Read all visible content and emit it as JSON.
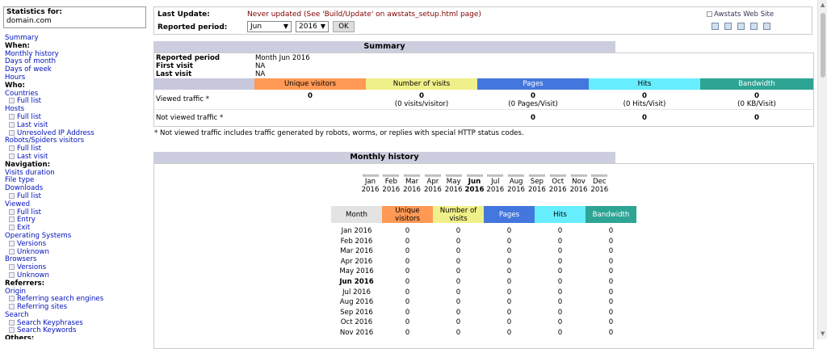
{
  "menu": {
    "stats_label": "Statistics for:",
    "domain": "domain.com",
    "items": [
      {
        "kind": "top",
        "label": "Summary"
      },
      {
        "kind": "hdr",
        "label": "When:"
      },
      {
        "kind": "top",
        "label": "Monthly history"
      },
      {
        "kind": "top",
        "label": "Days of month"
      },
      {
        "kind": "top",
        "label": "Days of week"
      },
      {
        "kind": "top",
        "label": "Hours"
      },
      {
        "kind": "hdr",
        "label": "Who:"
      },
      {
        "kind": "top",
        "label": "Countries"
      },
      {
        "kind": "sub",
        "label": "Full list"
      },
      {
        "kind": "top",
        "label": "Hosts"
      },
      {
        "kind": "sub",
        "label": "Full list"
      },
      {
        "kind": "sub",
        "label": "Last visit"
      },
      {
        "kind": "sub",
        "label": "Unresolved IP Address"
      },
      {
        "kind": "top",
        "label": "Robots/Spiders visitors"
      },
      {
        "kind": "sub",
        "label": "Full list"
      },
      {
        "kind": "sub",
        "label": "Last visit"
      },
      {
        "kind": "hdr",
        "label": "Navigation:"
      },
      {
        "kind": "top",
        "label": "Visits duration"
      },
      {
        "kind": "top",
        "label": "File type"
      },
      {
        "kind": "top",
        "label": "Downloads"
      },
      {
        "kind": "sub",
        "label": "Full list"
      },
      {
        "kind": "top",
        "label": "Viewed"
      },
      {
        "kind": "sub",
        "label": "Full list"
      },
      {
        "kind": "sub",
        "label": "Entry"
      },
      {
        "kind": "sub",
        "label": "Exit"
      },
      {
        "kind": "top",
        "label": "Operating Systems"
      },
      {
        "kind": "sub",
        "label": "Versions"
      },
      {
        "kind": "sub",
        "label": "Unknown"
      },
      {
        "kind": "top",
        "label": "Browsers"
      },
      {
        "kind": "sub",
        "label": "Versions"
      },
      {
        "kind": "sub",
        "label": "Unknown"
      },
      {
        "kind": "hdr",
        "label": "Referrers:"
      },
      {
        "kind": "top",
        "label": "Origin"
      },
      {
        "kind": "sub",
        "label": "Referring search engines"
      },
      {
        "kind": "sub",
        "label": "Referring sites"
      },
      {
        "kind": "top",
        "label": "Search"
      },
      {
        "kind": "sub",
        "label": "Search Keyphrases"
      },
      {
        "kind": "sub",
        "label": "Search Keywords"
      },
      {
        "kind": "hdr",
        "label": "Others:"
      }
    ]
  },
  "header": {
    "last_update_label": "Last Update:",
    "last_update_value": "Never updated (See 'Build/Update' on awstats_setup.html page)",
    "reported_period_label": "Reported period:",
    "month_select": "Jun",
    "year_select": "2016",
    "ok_button": "OK",
    "logo_alt": "Awstats Web Site",
    "tool_icons": [
      "tool-icon-1",
      "tool-icon-2",
      "tool-icon-3",
      "tool-icon-4",
      "tool-icon-5"
    ]
  },
  "summary": {
    "title": "Summary",
    "reported_period_label": "Reported period",
    "reported_period_value": "Month Jun 2016",
    "first_visit_label": "First visit",
    "first_visit_value": "NA",
    "last_visit_label": "Last visit",
    "last_visit_value": "NA",
    "columns": [
      "Unique visitors",
      "Number of visits",
      "Pages",
      "Hits",
      "Bandwidth"
    ],
    "viewed_label": "Viewed traffic *",
    "viewed": {
      "unique_visitors": "0",
      "visits": "0",
      "visits_sub": "(0 visits/visitor)",
      "pages": "0",
      "pages_sub": "(0 Pages/Visit)",
      "hits": "0",
      "hits_sub": "(0 Hits/Visit)",
      "bandwidth": "0",
      "bandwidth_sub": "(0 KB/Visit)"
    },
    "not_viewed_label": "Not viewed traffic *",
    "not_viewed": {
      "pages": "0",
      "hits": "0",
      "bandwidth": "0"
    },
    "note": "* Not viewed traffic includes traffic generated by robots, worms, or replies with special HTTP status codes."
  },
  "monthly": {
    "title": "Monthly history",
    "chart_months": [
      {
        "m": "Jan",
        "y": "2016"
      },
      {
        "m": "Feb",
        "y": "2016"
      },
      {
        "m": "Mar",
        "y": "2016"
      },
      {
        "m": "Apr",
        "y": "2016"
      },
      {
        "m": "May",
        "y": "2016"
      },
      {
        "m": "Jun",
        "y": "2016",
        "current": true
      },
      {
        "m": "Jul",
        "y": "2016"
      },
      {
        "m": "Aug",
        "y": "2016"
      },
      {
        "m": "Sep",
        "y": "2016"
      },
      {
        "m": "Oct",
        "y": "2016"
      },
      {
        "m": "Nov",
        "y": "2016"
      },
      {
        "m": "Dec",
        "y": "2016"
      }
    ],
    "table_headers": [
      "Month",
      "Unique visitors",
      "Number of visits",
      "Pages",
      "Hits",
      "Bandwidth"
    ],
    "rows": [
      {
        "month": "Jan 2016",
        "uv": "0",
        "nv": "0",
        "pg": "0",
        "ht": "0",
        "bw": "0"
      },
      {
        "month": "Feb 2016",
        "uv": "0",
        "nv": "0",
        "pg": "0",
        "ht": "0",
        "bw": "0"
      },
      {
        "month": "Mar 2016",
        "uv": "0",
        "nv": "0",
        "pg": "0",
        "ht": "0",
        "bw": "0"
      },
      {
        "month": "Apr 2016",
        "uv": "0",
        "nv": "0",
        "pg": "0",
        "ht": "0",
        "bw": "0"
      },
      {
        "month": "May 2016",
        "uv": "0",
        "nv": "0",
        "pg": "0",
        "ht": "0",
        "bw": "0"
      },
      {
        "month": "Jun 2016",
        "uv": "0",
        "nv": "0",
        "pg": "0",
        "ht": "0",
        "bw": "0",
        "current": true
      },
      {
        "month": "Jul 2016",
        "uv": "0",
        "nv": "0",
        "pg": "0",
        "ht": "0",
        "bw": "0"
      },
      {
        "month": "Aug 2016",
        "uv": "0",
        "nv": "0",
        "pg": "0",
        "ht": "0",
        "bw": "0"
      },
      {
        "month": "Sep 2016",
        "uv": "0",
        "nv": "0",
        "pg": "0",
        "ht": "0",
        "bw": "0"
      },
      {
        "month": "Oct 2016",
        "uv": "0",
        "nv": "0",
        "pg": "0",
        "ht": "0",
        "bw": "0"
      },
      {
        "month": "Nov 2016",
        "uv": "0",
        "nv": "0",
        "pg": "0",
        "ht": "0",
        "bw": "0"
      }
    ]
  },
  "colors": {
    "unique_visitors": "#ff9955",
    "visits": "#f0f08a",
    "pages": "#4477dd",
    "hits": "#66eeff",
    "bandwidth": "#2ea495",
    "section_title": "#cccdde",
    "link": "#0011bb",
    "last_update": "#800000"
  }
}
